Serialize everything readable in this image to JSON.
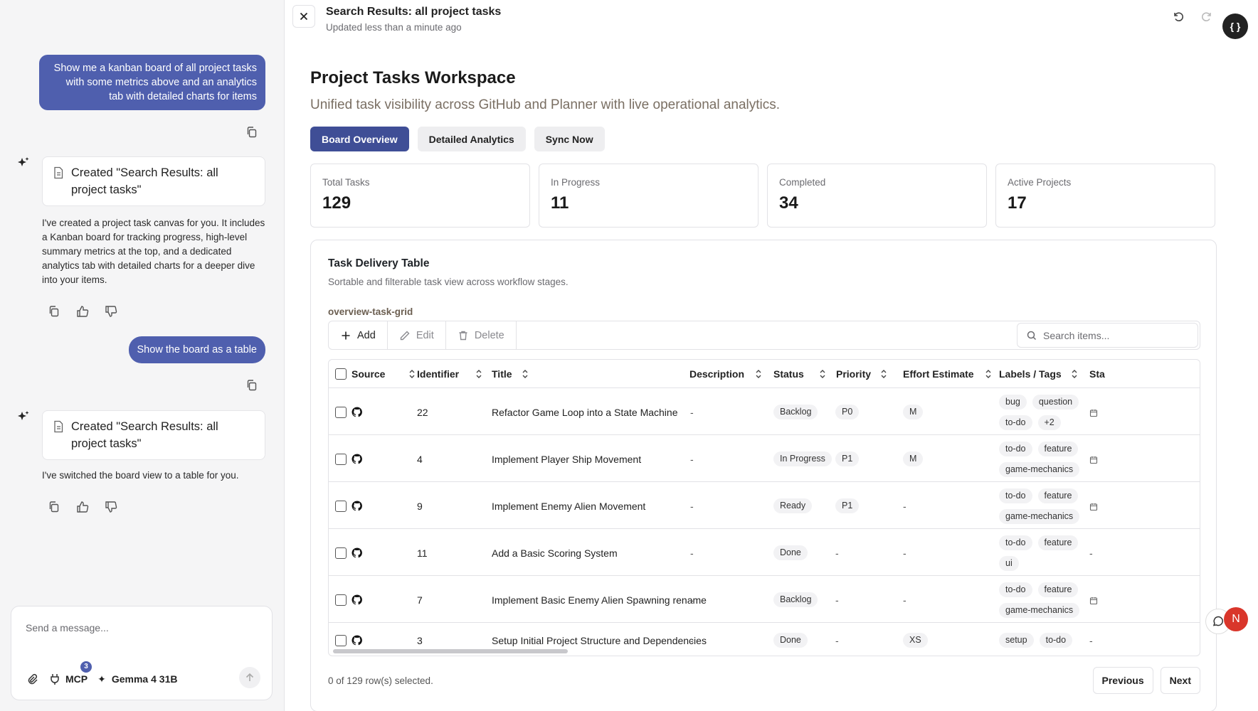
{
  "chat": {
    "messages": [
      {
        "role": "user",
        "text": "Show me a kanban board of all project tasks with some metrics above and an analytics tab with detailed charts for items"
      },
      {
        "role": "agent",
        "artifact": "Created \"Search Results: all project tasks\"",
        "text": "I've created a project task canvas for you. It includes a Kanban board for tracking progress, high-level summary metrics at the top, and a dedicated analytics tab with detailed charts for a deeper dive into your items."
      },
      {
        "role": "user",
        "text": "Show the board as a table"
      },
      {
        "role": "agent",
        "artifact": "Created \"Search Results: all project tasks\"",
        "text": "I've switched the board view to a table for you."
      }
    ],
    "composer": {
      "placeholder": "Send a message...",
      "mcp_label": "MCP",
      "mcp_count": "3",
      "model_label": "Gemma 4 31B"
    }
  },
  "canvas": {
    "title": "Search Results: all project tasks",
    "updated": "Updated less than a minute ago"
  },
  "page": {
    "title": "Project Tasks Workspace",
    "subtitle": "Unified task visibility across GitHub and Planner with live operational analytics.",
    "tabs": [
      "Board Overview",
      "Detailed Analytics",
      "Sync Now"
    ]
  },
  "metrics": [
    {
      "label": "Total Tasks",
      "value": "129"
    },
    {
      "label": "In Progress",
      "value": "11"
    },
    {
      "label": "Completed",
      "value": "34"
    },
    {
      "label": "Active Projects",
      "value": "17"
    }
  ],
  "table_card": {
    "title": "Task Delivery Table",
    "subtitle": "Sortable and filterable task view across workflow stages.",
    "grid_id": "overview-task-grid",
    "toolbar": {
      "add": "Add",
      "edit": "Edit",
      "delete": "Delete",
      "search_placeholder": "Search items..."
    },
    "columns": [
      "Source",
      "Identifier",
      "Title",
      "Description",
      "Status",
      "Priority",
      "Effort Estimate",
      "Labels / Tags",
      "Sta"
    ],
    "rows": [
      {
        "id": "22",
        "title": "Refactor Game Loop into a State Machine",
        "description": "-",
        "status": "Backlog",
        "priority": "P0",
        "effort": "M",
        "tags": [
          "bug",
          "question",
          "to-do",
          "+2"
        ],
        "start": "cal"
      },
      {
        "id": "4",
        "title": "Implement Player Ship Movement",
        "description": "-",
        "status": "In Progress",
        "priority": "P1",
        "effort": "M",
        "tags": [
          "to-do",
          "feature",
          "game-mechanics"
        ],
        "start": "cal"
      },
      {
        "id": "9",
        "title": "Implement Enemy Alien Movement",
        "description": "-",
        "status": "Ready",
        "priority": "P1",
        "effort": "-",
        "tags": [
          "to-do",
          "feature",
          "game-mechanics"
        ],
        "start": "cal"
      },
      {
        "id": "11",
        "title": "Add a Basic Scoring System",
        "description": "-",
        "status": "Done",
        "priority": "-",
        "effort": "-",
        "tags": [
          "to-do",
          "feature",
          "ui"
        ],
        "start": "-"
      },
      {
        "id": "7",
        "title": "Implement Basic Enemy Alien Spawning rename",
        "description": "-",
        "status": "Backlog",
        "priority": "-",
        "effort": "-",
        "tags": [
          "to-do",
          "feature",
          "game-mechanics"
        ],
        "start": "cal"
      },
      {
        "id": "3",
        "title": "Setup Initial Project Structure and Dependencies",
        "description": "-",
        "status": "Done",
        "priority": "-",
        "effort": "XS",
        "tags": [
          "setup",
          "to-do"
        ],
        "start": "-"
      }
    ],
    "selection": "0 of 129 row(s) selected.",
    "prev": "Previous",
    "next": "Next"
  },
  "avatar_initial": "N",
  "colors": {
    "accent": "#3f4e96",
    "user_bubble": "#4f5fae",
    "avatar": "#d9362b"
  }
}
